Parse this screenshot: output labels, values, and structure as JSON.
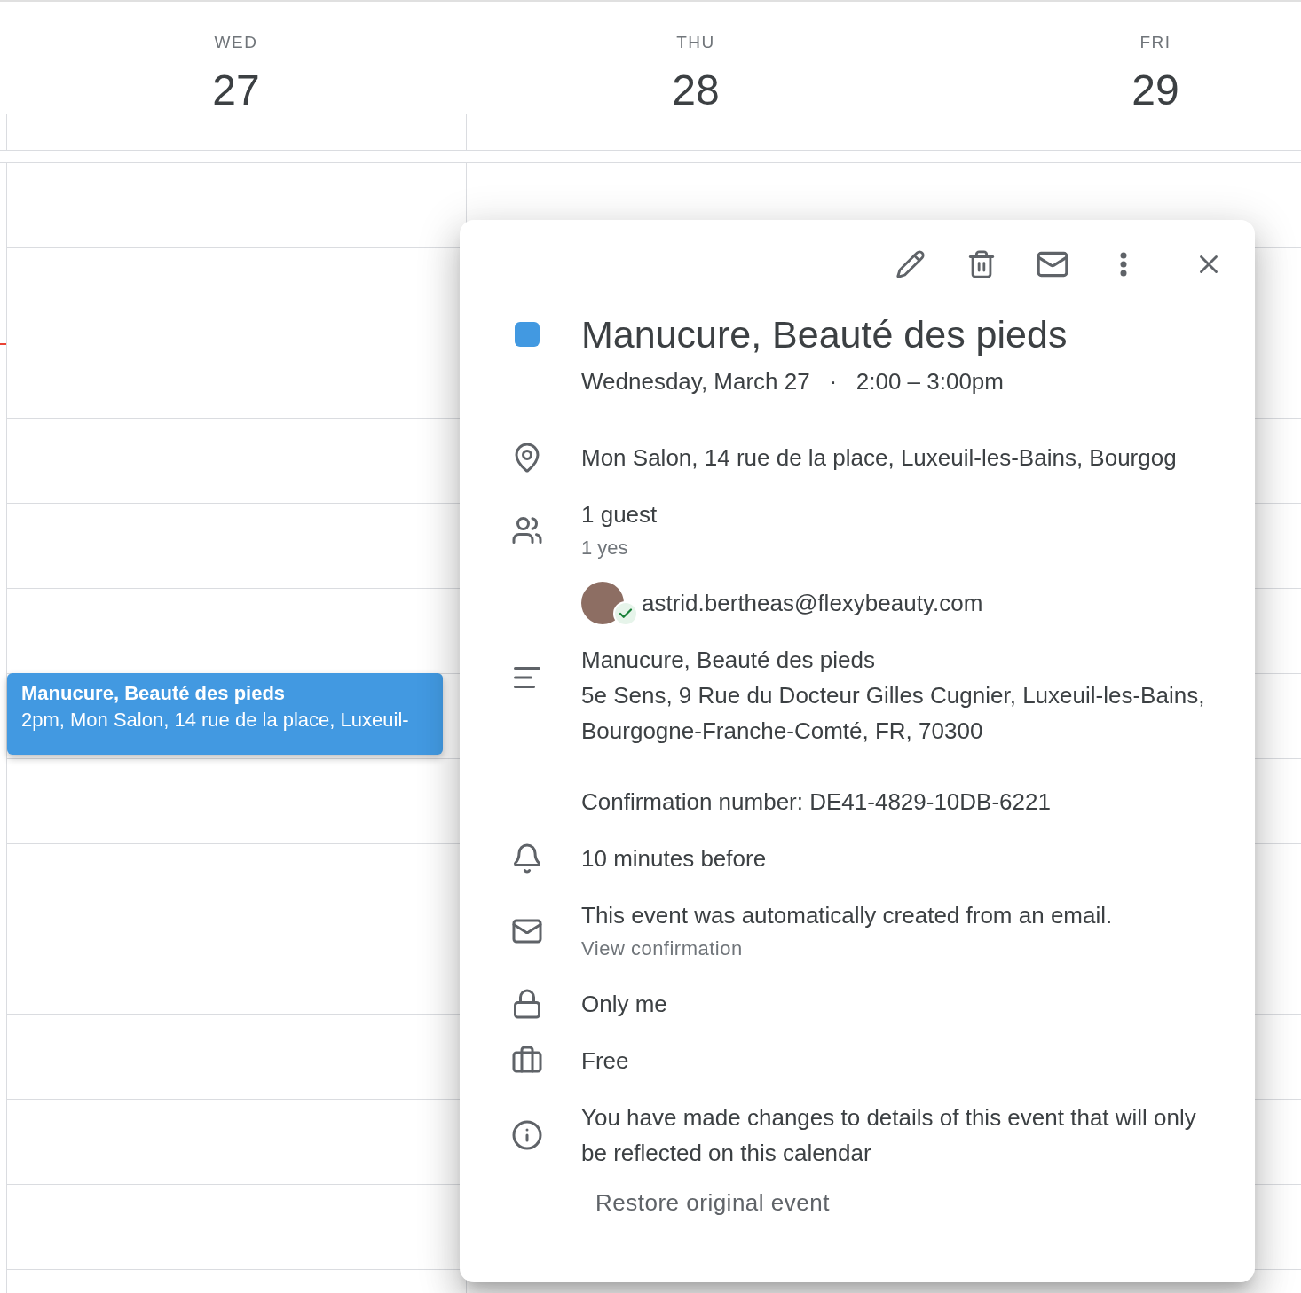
{
  "days": [
    {
      "weekday": "WED",
      "date": "27",
      "events": [
        {
          "title": "Manucure, Beauté des pieds",
          "details": "2pm, Mon Salon, 14 rue de la place, Luxeuil-"
        }
      ]
    },
    {
      "weekday": "THU",
      "date": "28"
    },
    {
      "weekday": "FRI",
      "date": "29"
    }
  ],
  "popup": {
    "title": "Manucure, Beauté des pieds",
    "date": "Wednesday, March 27",
    "separator": "·",
    "time": "2:00 – 3:00pm",
    "location": "Mon Salon, 14 rue de la place, Luxeuil-les-Bains, Bourgog",
    "guest_count": "1 guest",
    "guest_summary": "1 yes",
    "guests": [
      {
        "email": "astrid.bertheas@flexybeauty.com",
        "accepted": true
      }
    ],
    "description": [
      "Manucure, Beauté des pieds",
      "5e Sens, 9 Rue du Docteur Gilles Cugnier, Luxeuil-les-Bains, Bourgogne-Franche-Comté, FR, 70300"
    ],
    "confirmation": "Confirmation number: DE41-4829-10DB-6221",
    "reminder": "10 minutes before",
    "email_note": "This event was automatically created from an email.",
    "email_link": "View confirmation",
    "visibility": "Only me",
    "availability": "Free",
    "notice": "You have made changes to details of this event that will only be reflected on this calendar",
    "restore_button": "Restore original event"
  }
}
